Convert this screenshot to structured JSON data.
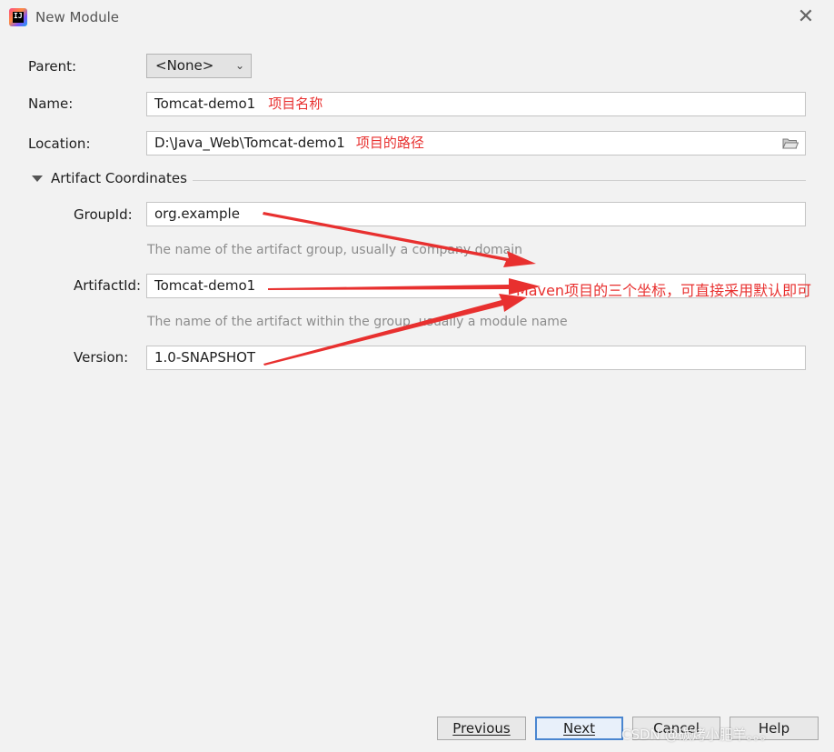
{
  "window": {
    "title": "New Module",
    "app_icon_text": "IJ"
  },
  "form": {
    "parent_label": "Parent:",
    "parent_value": "<None>",
    "name_label": "Name:",
    "name_value": "Tomcat-demo1",
    "name_note": "项目名称",
    "location_label": "Location:",
    "location_value": "D:\\Java_Web\\Tomcat-demo1",
    "location_note": "项目的路径"
  },
  "artifact": {
    "section_label": "Artifact Coordinates",
    "groupid_label": "GroupId:",
    "groupid_value": "org.example",
    "groupid_hint": "The name of the artifact group, usually a company domain",
    "artifactid_label": "ArtifactId:",
    "artifactid_value": "Tomcat-demo1",
    "artifactid_hint": "The name of the artifact within the group, usually a module name",
    "version_label": "Version:",
    "version_value": "1.0-SNAPSHOT"
  },
  "annotation": {
    "text": "Maven项目的三个坐标，可直接采用默认即可",
    "color": "#e8302f"
  },
  "buttons": {
    "previous": "Previous",
    "next": "Next",
    "cancel": "Cancel",
    "help": "Help"
  },
  "watermark": "CSDN @碳烤小肥羊。。。",
  "icons": {
    "close": "close-icon",
    "folder": "folder-icon",
    "dropdown": "chevron-down-icon",
    "collapse": "triangle-down-icon"
  }
}
